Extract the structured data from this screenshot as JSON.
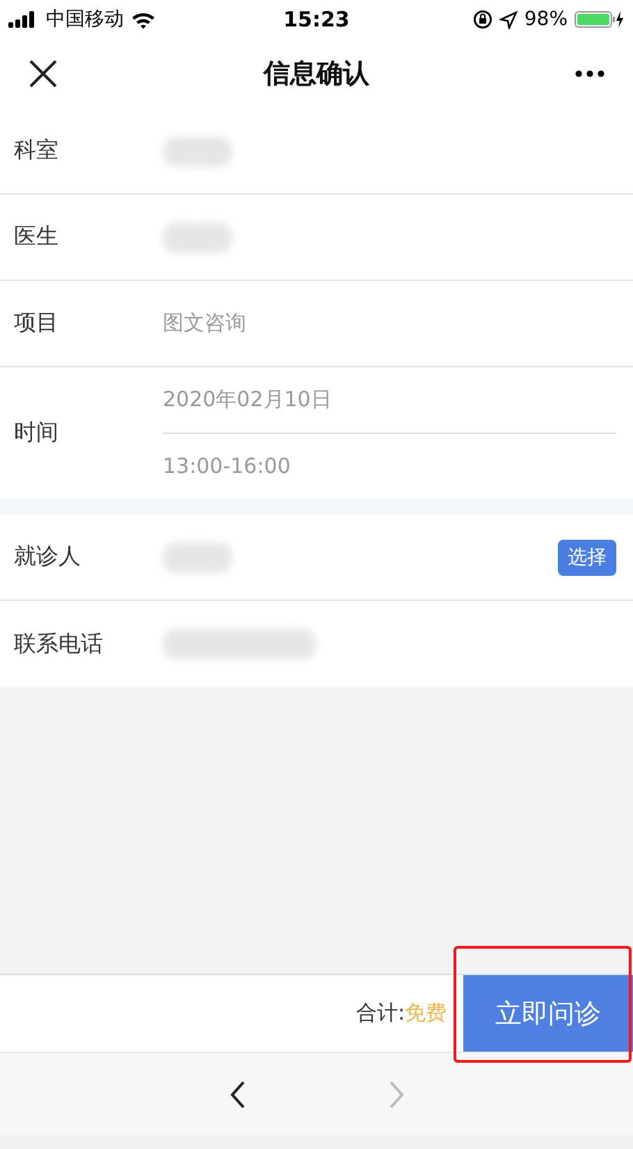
{
  "status_bar": {
    "carrier": "中国移动",
    "time": "15:23",
    "battery": "98%"
  },
  "nav": {
    "title": "信息确认"
  },
  "sections": [
    {
      "rows": [
        {
          "label": "科室",
          "kind": "redacted"
        },
        {
          "label": "医生",
          "kind": "redacted"
        },
        {
          "label": "项目",
          "kind": "text",
          "value": "图文咨询"
        },
        {
          "label": "时间",
          "kind": "lines",
          "values": [
            "2020年02月10日",
            "13:00-16:00"
          ]
        }
      ]
    },
    {
      "rows": [
        {
          "label": "就诊人",
          "kind": "redacted",
          "action": "选择"
        },
        {
          "label": "联系电话",
          "kind": "redacted-phone"
        }
      ]
    }
  ],
  "footer": {
    "total_label": "合计:",
    "total_value": "免费",
    "submit": "立即问诊",
    "highlighted": true
  },
  "toolbar": [
    {
      "kind": "back",
      "disabled": false
    },
    {
      "kind": "forward",
      "disabled": true
    }
  ]
}
